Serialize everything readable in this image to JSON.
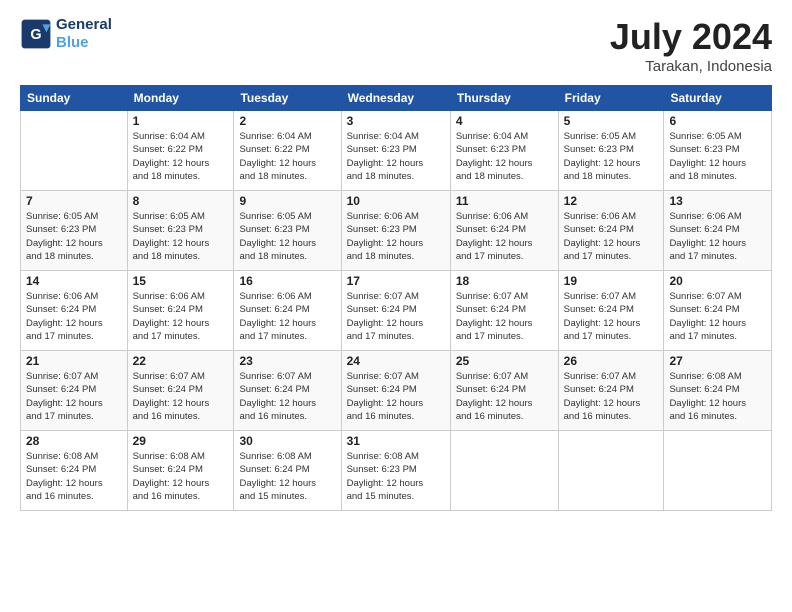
{
  "header": {
    "logo_line1": "General",
    "logo_line2": "Blue",
    "month_year": "July 2024",
    "location": "Tarakan, Indonesia"
  },
  "days_of_week": [
    "Sunday",
    "Monday",
    "Tuesday",
    "Wednesday",
    "Thursday",
    "Friday",
    "Saturday"
  ],
  "weeks": [
    [
      {
        "num": "",
        "info": ""
      },
      {
        "num": "1",
        "info": "Sunrise: 6:04 AM\nSunset: 6:22 PM\nDaylight: 12 hours\nand 18 minutes."
      },
      {
        "num": "2",
        "info": "Sunrise: 6:04 AM\nSunset: 6:22 PM\nDaylight: 12 hours\nand 18 minutes."
      },
      {
        "num": "3",
        "info": "Sunrise: 6:04 AM\nSunset: 6:23 PM\nDaylight: 12 hours\nand 18 minutes."
      },
      {
        "num": "4",
        "info": "Sunrise: 6:04 AM\nSunset: 6:23 PM\nDaylight: 12 hours\nand 18 minutes."
      },
      {
        "num": "5",
        "info": "Sunrise: 6:05 AM\nSunset: 6:23 PM\nDaylight: 12 hours\nand 18 minutes."
      },
      {
        "num": "6",
        "info": "Sunrise: 6:05 AM\nSunset: 6:23 PM\nDaylight: 12 hours\nand 18 minutes."
      }
    ],
    [
      {
        "num": "7",
        "info": "Sunrise: 6:05 AM\nSunset: 6:23 PM\nDaylight: 12 hours\nand 18 minutes."
      },
      {
        "num": "8",
        "info": "Sunrise: 6:05 AM\nSunset: 6:23 PM\nDaylight: 12 hours\nand 18 minutes."
      },
      {
        "num": "9",
        "info": "Sunrise: 6:05 AM\nSunset: 6:23 PM\nDaylight: 12 hours\nand 18 minutes."
      },
      {
        "num": "10",
        "info": "Sunrise: 6:06 AM\nSunset: 6:23 PM\nDaylight: 12 hours\nand 18 minutes."
      },
      {
        "num": "11",
        "info": "Sunrise: 6:06 AM\nSunset: 6:24 PM\nDaylight: 12 hours\nand 17 minutes."
      },
      {
        "num": "12",
        "info": "Sunrise: 6:06 AM\nSunset: 6:24 PM\nDaylight: 12 hours\nand 17 minutes."
      },
      {
        "num": "13",
        "info": "Sunrise: 6:06 AM\nSunset: 6:24 PM\nDaylight: 12 hours\nand 17 minutes."
      }
    ],
    [
      {
        "num": "14",
        "info": "Sunrise: 6:06 AM\nSunset: 6:24 PM\nDaylight: 12 hours\nand 17 minutes."
      },
      {
        "num": "15",
        "info": "Sunrise: 6:06 AM\nSunset: 6:24 PM\nDaylight: 12 hours\nand 17 minutes."
      },
      {
        "num": "16",
        "info": "Sunrise: 6:06 AM\nSunset: 6:24 PM\nDaylight: 12 hours\nand 17 minutes."
      },
      {
        "num": "17",
        "info": "Sunrise: 6:07 AM\nSunset: 6:24 PM\nDaylight: 12 hours\nand 17 minutes."
      },
      {
        "num": "18",
        "info": "Sunrise: 6:07 AM\nSunset: 6:24 PM\nDaylight: 12 hours\nand 17 minutes."
      },
      {
        "num": "19",
        "info": "Sunrise: 6:07 AM\nSunset: 6:24 PM\nDaylight: 12 hours\nand 17 minutes."
      },
      {
        "num": "20",
        "info": "Sunrise: 6:07 AM\nSunset: 6:24 PM\nDaylight: 12 hours\nand 17 minutes."
      }
    ],
    [
      {
        "num": "21",
        "info": "Sunrise: 6:07 AM\nSunset: 6:24 PM\nDaylight: 12 hours\nand 17 minutes."
      },
      {
        "num": "22",
        "info": "Sunrise: 6:07 AM\nSunset: 6:24 PM\nDaylight: 12 hours\nand 16 minutes."
      },
      {
        "num": "23",
        "info": "Sunrise: 6:07 AM\nSunset: 6:24 PM\nDaylight: 12 hours\nand 16 minutes."
      },
      {
        "num": "24",
        "info": "Sunrise: 6:07 AM\nSunset: 6:24 PM\nDaylight: 12 hours\nand 16 minutes."
      },
      {
        "num": "25",
        "info": "Sunrise: 6:07 AM\nSunset: 6:24 PM\nDaylight: 12 hours\nand 16 minutes."
      },
      {
        "num": "26",
        "info": "Sunrise: 6:07 AM\nSunset: 6:24 PM\nDaylight: 12 hours\nand 16 minutes."
      },
      {
        "num": "27",
        "info": "Sunrise: 6:08 AM\nSunset: 6:24 PM\nDaylight: 12 hours\nand 16 minutes."
      }
    ],
    [
      {
        "num": "28",
        "info": "Sunrise: 6:08 AM\nSunset: 6:24 PM\nDaylight: 12 hours\nand 16 minutes."
      },
      {
        "num": "29",
        "info": "Sunrise: 6:08 AM\nSunset: 6:24 PM\nDaylight: 12 hours\nand 16 minutes."
      },
      {
        "num": "30",
        "info": "Sunrise: 6:08 AM\nSunset: 6:24 PM\nDaylight: 12 hours\nand 15 minutes."
      },
      {
        "num": "31",
        "info": "Sunrise: 6:08 AM\nSunset: 6:23 PM\nDaylight: 12 hours\nand 15 minutes."
      },
      {
        "num": "",
        "info": ""
      },
      {
        "num": "",
        "info": ""
      },
      {
        "num": "",
        "info": ""
      }
    ]
  ]
}
